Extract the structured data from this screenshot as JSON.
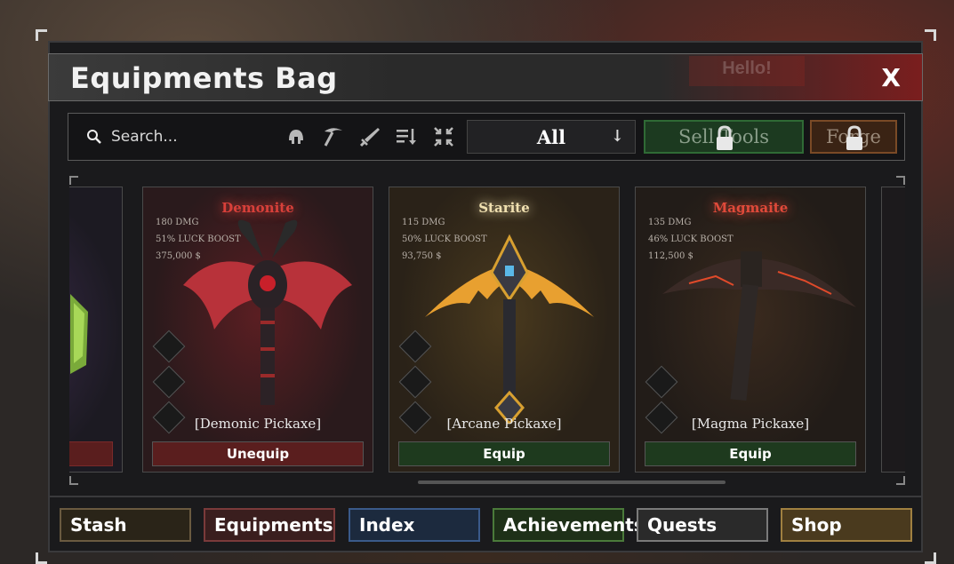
{
  "window": {
    "title": "Equipments Bag",
    "background_hint": "Hello!",
    "close_label": "X"
  },
  "toolbar": {
    "search_placeholder": "Search...",
    "filter_icons": [
      "helmet-icon",
      "pickaxe-icon",
      "sword-icon",
      "sort-icon",
      "collapse-icon"
    ],
    "filter_value": "All",
    "sell_label": "Sell Tools",
    "forge_label": "Forge"
  },
  "cards": [
    {
      "ore": "Demonite",
      "ore_color": "#d8403a",
      "damage": "180 DMG",
      "luck": "51% LUCK BOOST",
      "price": "375,000 $",
      "tool": "[Demonic Pickaxe]",
      "action": "Unequip",
      "action_color": "#5a1e1e"
    },
    {
      "ore": "Starite",
      "ore_color": "#f0e0b0",
      "damage": "115 DMG",
      "luck": "50% LUCK BOOST",
      "price": "93,750 $",
      "tool": "[Arcane Pickaxe]",
      "action": "Equip",
      "action_color": "#1e3a1e"
    },
    {
      "ore": "Magmaite",
      "ore_color": "#e04a3a",
      "damage": "135 DMG",
      "luck": "46% LUCK BOOST",
      "price": "112,500 $",
      "tool": "[Magma Pickaxe]",
      "action": "Equip",
      "action_color": "#1e3a1e"
    }
  ],
  "tabs": [
    {
      "label": "Stash",
      "border": "#6a5a40",
      "bg": "#2a2418"
    },
    {
      "label": "Equipments",
      "border": "#7a3a3a",
      "bg": "#3a1e1e"
    },
    {
      "label": "Index",
      "border": "#3a5a8a",
      "bg": "#1c2a3e"
    },
    {
      "label": "Achievements",
      "border": "#4a7a3a",
      "bg": "#1e3018"
    },
    {
      "label": "Quests",
      "border": "#7a7a7a",
      "bg": "#2a2a2a"
    },
    {
      "label": "Shop",
      "border": "#a08040",
      "bg": "#4a3a1e"
    }
  ]
}
